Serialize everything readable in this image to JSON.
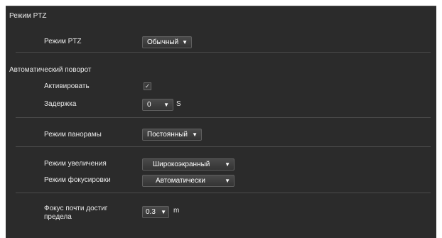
{
  "sections": {
    "ptz": {
      "title": "Режим PTZ",
      "mode_label": "Режим PTZ",
      "mode_value": "Обычный"
    },
    "auto_rotate": {
      "title": "Автоматический поворот",
      "activate_label": "Активировать",
      "activate_checked": true,
      "delay_label": "Задержка",
      "delay_value": "0",
      "delay_unit": "S"
    },
    "panorama": {
      "label": "Режим панорамы",
      "value": "Постоянный"
    },
    "zoom": {
      "label": "Режим увеличения",
      "value": "Широкоэкранный"
    },
    "focus": {
      "label": "Режим фокусировки",
      "value": "Автоматически"
    },
    "near_focus": {
      "label_line1": "Фокус почти достиг",
      "label_line2": "предела",
      "value": "0.3",
      "unit": "m"
    }
  },
  "icons": {
    "dropdown": "caret-down-icon",
    "checkbox": "checkmark-icon"
  },
  "colors": {
    "panel_bg": "#2b2b2b",
    "text": "#e8e8e8",
    "divider": "#4b4b4b"
  }
}
